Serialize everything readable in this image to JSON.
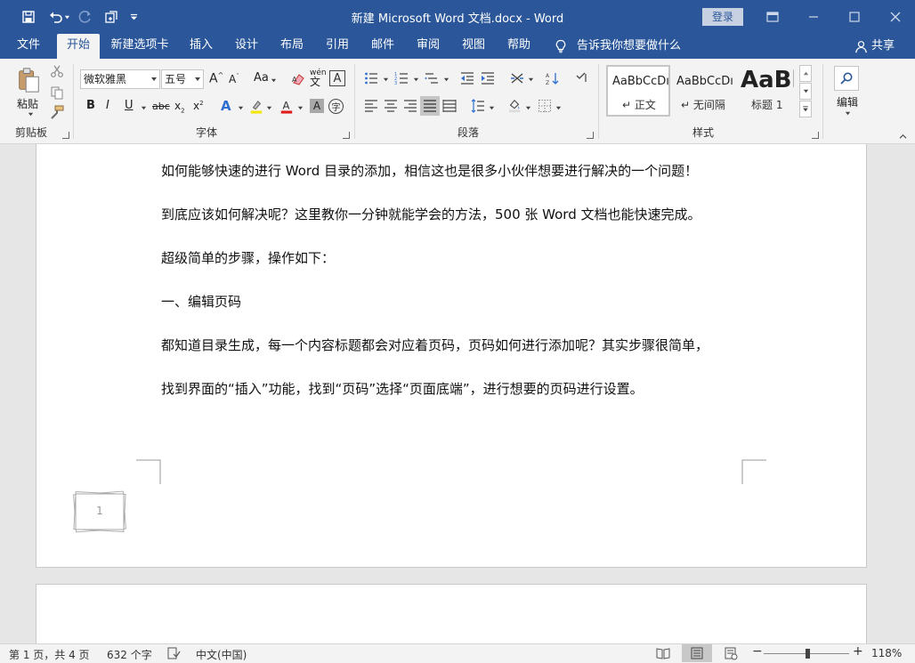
{
  "titlebar": {
    "title": "新建 Microsoft Word 文档.docx  -  Word",
    "login": "登录"
  },
  "tabs": [
    "文件",
    "开始",
    "新建选项卡",
    "插入",
    "设计",
    "布局",
    "引用",
    "邮件",
    "审阅",
    "视图",
    "帮助"
  ],
  "tellme": "告诉我你想要做什么",
  "share": "共享",
  "ribbon": {
    "clipboard": {
      "paste": "粘贴",
      "label": "剪贴板"
    },
    "font": {
      "name": "微软雅黑",
      "size": "五号",
      "label": "字体",
      "change_case": "Aa",
      "phonetic": "wén"
    },
    "paragraph": {
      "label": "段落"
    },
    "styles": {
      "label": "样式",
      "items": [
        {
          "sample": "AaBbCcDı",
          "name": "↵ 正文"
        },
        {
          "sample": "AaBbCcDı",
          "name": "↵ 无间隔"
        },
        {
          "sample": "AaBl",
          "name": "标题 1"
        }
      ]
    },
    "editing": {
      "label": "编辑"
    }
  },
  "document": {
    "paragraphs": [
      "如何能够快速的进行 Word 目录的添加，相信这也是很多小伙伴想要进行解决的一个问题！",
      "到底应该如何解决呢？这里教你一分钟就能学会的方法，500 张 Word 文档也能快速完成。",
      "超级简单的步骤，操作如下：",
      "一、编辑页码",
      "都知道目录生成，每一个内容标题都会对应着页码，页码如何进行添加呢？其实步骤很简单，",
      "找到界面的“插入”功能，找到“页码”选择“页面底端”，进行想要的页码进行设置。"
    ],
    "page_number_preview": "1"
  },
  "status": {
    "page": "第 1 页，共 4 页",
    "words": "632 个字",
    "language": "中文(中国)",
    "zoom": "118%",
    "zoom_level": 118
  },
  "colors": {
    "accent": "#2b579a",
    "ribbon_bg": "#f3f3f3",
    "doc_bg": "#e6e6e6"
  }
}
